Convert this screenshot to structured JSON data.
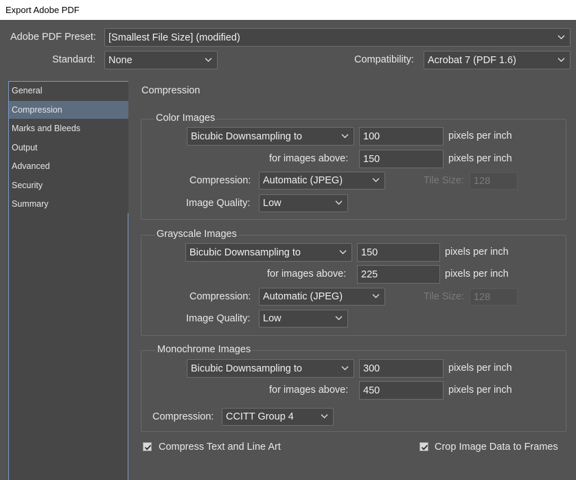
{
  "window": {
    "title": "Export Adobe PDF"
  },
  "preset": {
    "label": "Adobe PDF Preset:",
    "value": "[Smallest File Size] (modified)"
  },
  "standard": {
    "label": "Standard:",
    "value": "None"
  },
  "compatibility": {
    "label": "Compatibility:",
    "value": "Acrobat 7 (PDF 1.6)"
  },
  "sidebar": {
    "items": [
      {
        "label": "General"
      },
      {
        "label": "Compression"
      },
      {
        "label": "Marks and Bleeds"
      },
      {
        "label": "Output"
      },
      {
        "label": "Advanced"
      },
      {
        "label": "Security"
      },
      {
        "label": "Summary"
      }
    ]
  },
  "section_title": "Compression",
  "color": {
    "title": "Color Images",
    "downsampling": "Bicubic Downsampling to",
    "ppi": "100",
    "ppi_unit": "pixels per inch",
    "above_label": "for images above:",
    "above_value": "150",
    "above_unit": "pixels per inch",
    "compression_label": "Compression:",
    "compression": "Automatic (JPEG)",
    "tile_label": "Tile Size:",
    "tile_value": "128",
    "quality_label": "Image Quality:",
    "quality": "Low"
  },
  "gray": {
    "title": "Grayscale Images",
    "downsampling": "Bicubic Downsampling to",
    "ppi": "150",
    "ppi_unit": "pixels per inch",
    "above_label": "for images above:",
    "above_value": "225",
    "above_unit": "pixels per inch",
    "compression_label": "Compression:",
    "compression": "Automatic (JPEG)",
    "tile_label": "Tile Size:",
    "tile_value": "128",
    "quality_label": "Image Quality:",
    "quality": "Low"
  },
  "mono": {
    "title": "Monochrome Images",
    "downsampling": "Bicubic Downsampling to",
    "ppi": "300",
    "ppi_unit": "pixels per inch",
    "above_label": "for images above:",
    "above_value": "450",
    "above_unit": "pixels per inch",
    "compression_label": "Compression:",
    "compression": "CCITT Group 4"
  },
  "options": {
    "compress_text": {
      "label": "Compress Text and Line Art",
      "checked": true
    },
    "crop_image": {
      "label": "Crop Image Data to Frames",
      "checked": true
    }
  },
  "icons": {
    "dropdown": "chevron-down-icon",
    "checkbox": "checkmark-icon"
  },
  "colors": {
    "background": "#535353",
    "sidebar_selected": "#5d6d80",
    "sidebar_border": "#7a9cc6"
  }
}
